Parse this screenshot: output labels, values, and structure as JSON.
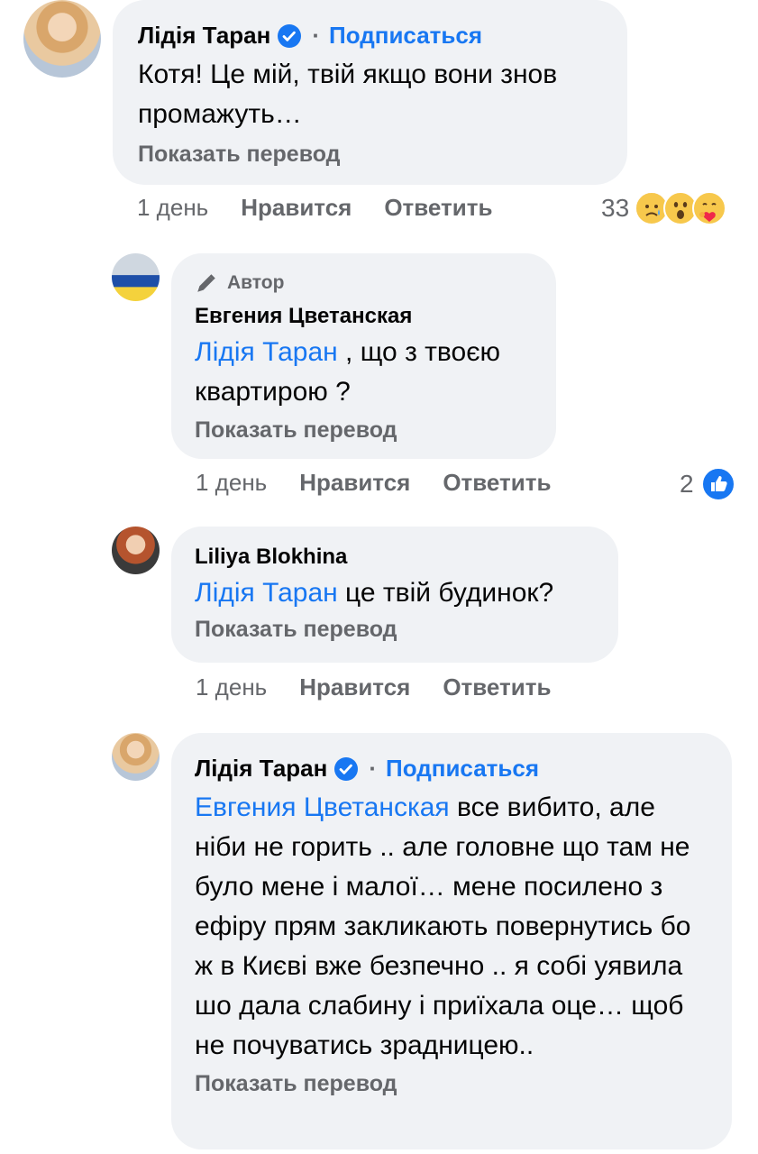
{
  "comments": [
    {
      "name": "Лідія Таран",
      "follow": "Подписаться",
      "dot": "·",
      "text": "Котя! Це мій, твій якщо вони знов промажуть…",
      "translate": "Показать перевод",
      "time": "1 день",
      "like": "Нравится",
      "reply": "Ответить",
      "reaction_count": "33"
    },
    {
      "author_tag": "Автор",
      "name": "Евгения Цветанская",
      "mention": "Лідія Таран",
      "text": " , що з твоєю квартирою ?",
      "translate": "Показать перевод",
      "time": "1 день",
      "like": "Нравится",
      "reply": "Ответить",
      "reaction_count": "2"
    },
    {
      "name": "Liliya Blokhina",
      "mention": "Лідія Таран",
      "text": " це твій будинок?",
      "translate": "Показать перевод",
      "time": "1 день",
      "like": "Нравится",
      "reply": "Ответить"
    },
    {
      "name": "Лідія Таран",
      "follow": "Подписаться",
      "dot": "·",
      "mention": "Евгения Цветанская",
      "text": "  все вибито, але ніби не горить .. але головне що там не було мене і малої… мене посилено з ефіру прям закликають повернутись бо ж в Києві вже безпечно .. я собі уявила шо дала слабину і приїхала оце… щоб не почуватись зрадницею..",
      "translate": "Показать перевод"
    }
  ],
  "colors": {
    "link": "#1877f2",
    "bubble": "#f0f2f5",
    "meta": "#65676b"
  },
  "icons": [
    "verified-badge-icon",
    "sad-reaction-icon",
    "wow-reaction-icon",
    "care-reaction-icon",
    "like-reaction-icon",
    "pen-icon"
  ]
}
